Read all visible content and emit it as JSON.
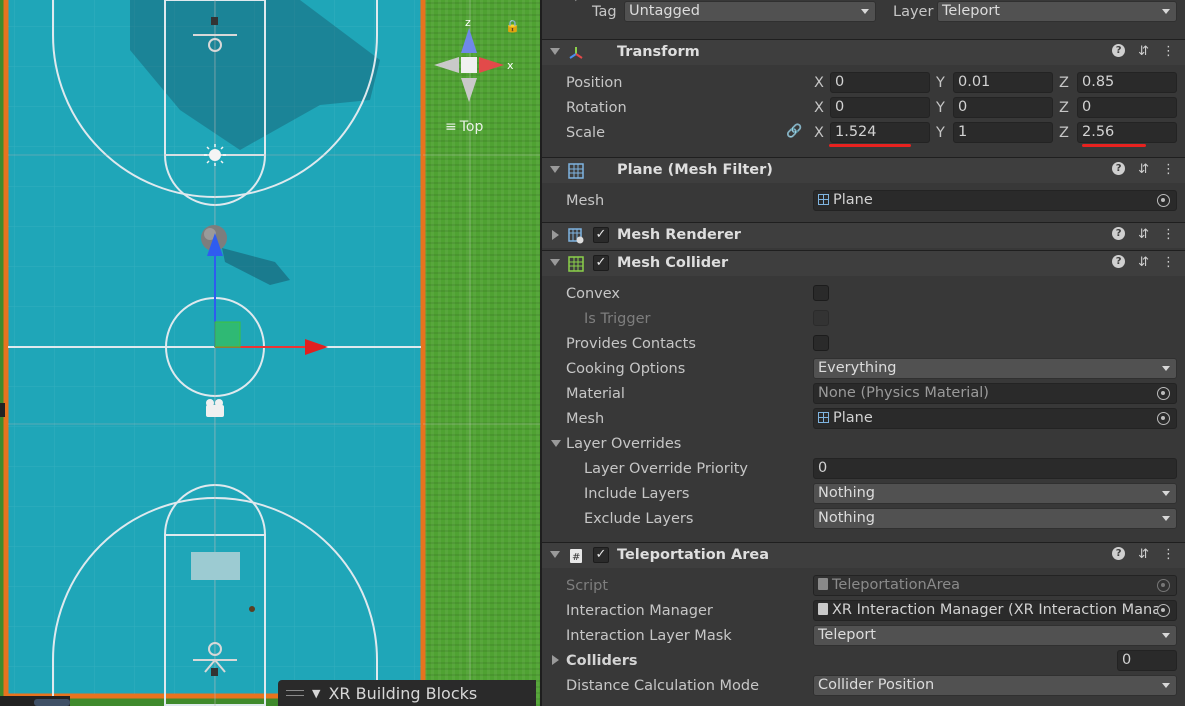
{
  "scene": {
    "orientation_label": "Top",
    "gizmo_axes": {
      "z": "z",
      "x": "x"
    },
    "bottom_tab": "XR Building Blocks"
  },
  "inspector": {
    "tag_label": "Tag",
    "tag_value": "Untagged",
    "layer_label": "Layer",
    "layer_value": "Teleport",
    "transform": {
      "title": "Transform",
      "position_label": "Position",
      "rotation_label": "Rotation",
      "scale_label": "Scale",
      "axis_x": "X",
      "axis_y": "Y",
      "axis_z": "Z",
      "position": {
        "x": "0",
        "y": "0.01",
        "z": "0.85"
      },
      "rotation": {
        "x": "0",
        "y": "0",
        "z": "0"
      },
      "scale": {
        "x": "1.524",
        "y": "1",
        "z": "2.56"
      }
    },
    "mesh_filter": {
      "title": "Plane (Mesh Filter)",
      "mesh_label": "Mesh",
      "mesh_value": "Plane"
    },
    "mesh_renderer": {
      "title": "Mesh Renderer"
    },
    "mesh_collider": {
      "title": "Mesh Collider",
      "convex_label": "Convex",
      "is_trigger_label": "Is Trigger",
      "provides_contacts_label": "Provides Contacts",
      "cooking_options_label": "Cooking Options",
      "cooking_options_value": "Everything",
      "material_label": "Material",
      "material_value": "None (Physics Material)",
      "mesh_label": "Mesh",
      "mesh_value": "Plane",
      "layer_overrides_label": "Layer Overrides",
      "layer_override_priority_label": "Layer Override Priority",
      "layer_override_priority_value": "0",
      "include_layers_label": "Include Layers",
      "include_layers_value": "Nothing",
      "exclude_layers_label": "Exclude Layers",
      "exclude_layers_value": "Nothing"
    },
    "teleportation_area": {
      "title": "Teleportation Area",
      "script_label": "Script",
      "script_value": "TeleportationArea",
      "interaction_manager_label": "Interaction Manager",
      "interaction_manager_value": "XR Interaction Manager (XR Interaction Mana",
      "interaction_layer_mask_label": "Interaction Layer Mask",
      "interaction_layer_mask_value": "Teleport",
      "colliders_label": "Colliders",
      "colliders_count": "0",
      "distance_calc_label": "Distance Calculation Mode",
      "distance_calc_value": "Collider Position"
    }
  },
  "colors": {
    "court": "#1fa6b8",
    "court_border": "#e8731e",
    "grass": "#4fa232",
    "inspector_bg": "#383838",
    "header_bg": "#3e3e3e",
    "highlight_underline": "#e8221f"
  }
}
